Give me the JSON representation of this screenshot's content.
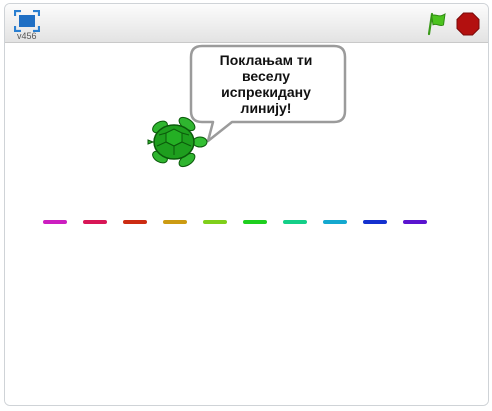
{
  "player": {
    "version_label": "v456",
    "fullscreen_icon": "fullscreen-icon",
    "green_flag_icon": "green-flag-icon",
    "stop_icon": "stop-sign-icon"
  },
  "stage": {
    "sprite_name": "turtle",
    "speech": {
      "line1": "Поклањам ти",
      "line2": "веселу",
      "line3": "испрекидану",
      "line4": "линију!"
    },
    "dash_colors": [
      "#cc1ec0",
      "#d81656",
      "#cc2b12",
      "#cc9b12",
      "#7fcf1a",
      "#1ecf1e",
      "#14cf88",
      "#14a8cf",
      "#1430cf",
      "#5a14cf"
    ]
  }
}
